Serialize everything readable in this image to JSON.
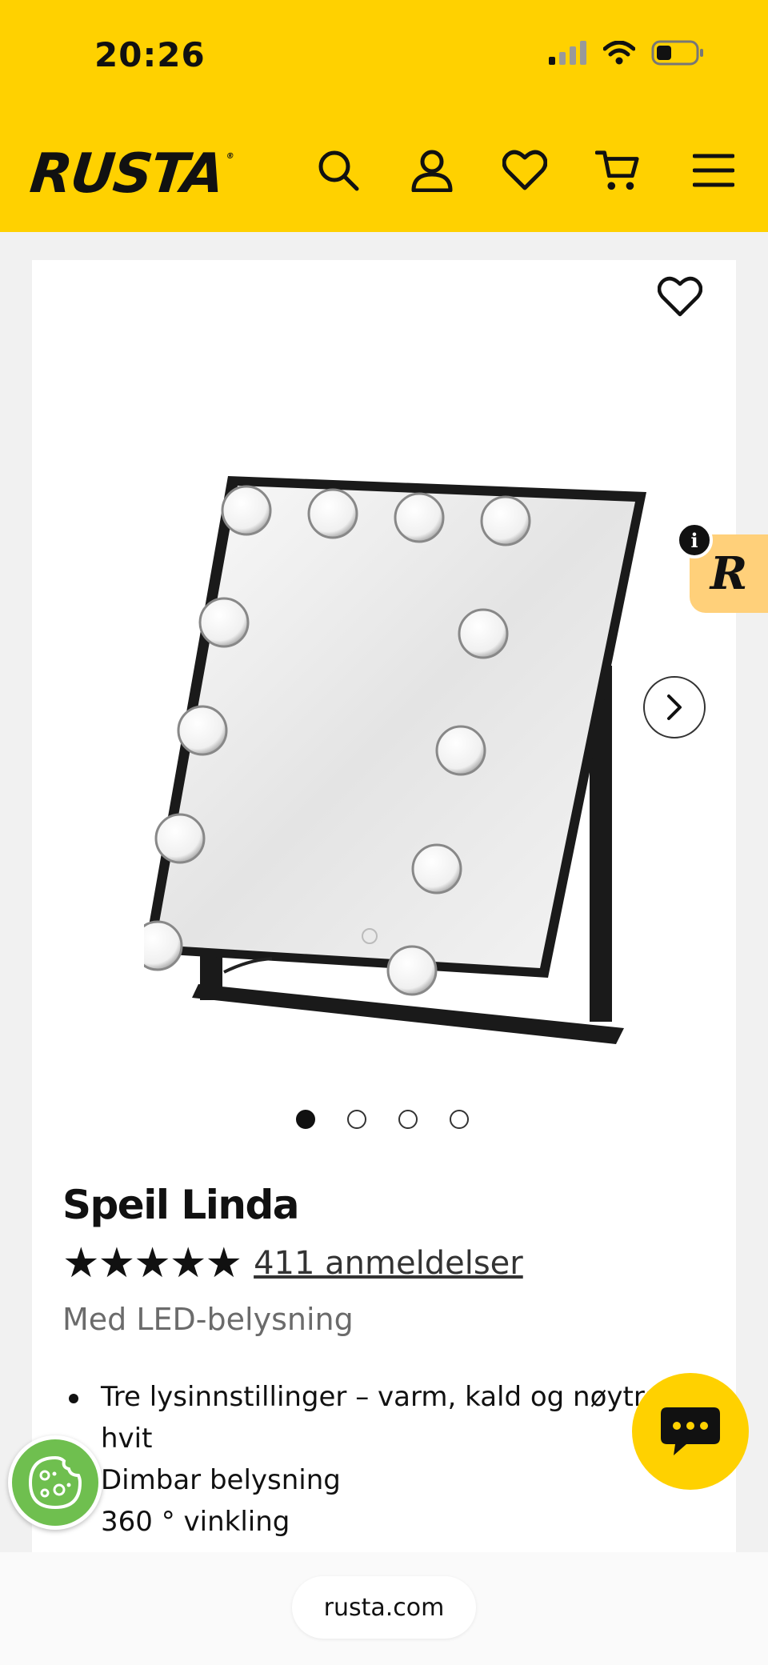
{
  "status": {
    "time": "20:26"
  },
  "header": {
    "logo": "RUSTA"
  },
  "product": {
    "title": "Speil Linda",
    "stars": "★★★★★",
    "reviews": "411 anmeldelser",
    "subtitle": "Med LED-belysning",
    "features": [
      "Tre lysinnstillinger – varm, kald og nøytral",
      "hvit",
      "Dimbar belysning",
      "360 ° vinkling"
    ],
    "gallery_image_count": 4,
    "gallery_active_index": 0
  },
  "overlays": {
    "r_badge": "R",
    "info": "i"
  },
  "browser": {
    "url": "rusta.com"
  },
  "colors": {
    "brand_yellow": "#ffd100",
    "badge_orange": "#ffd07a",
    "cookie_green": "#6fbf4f"
  }
}
